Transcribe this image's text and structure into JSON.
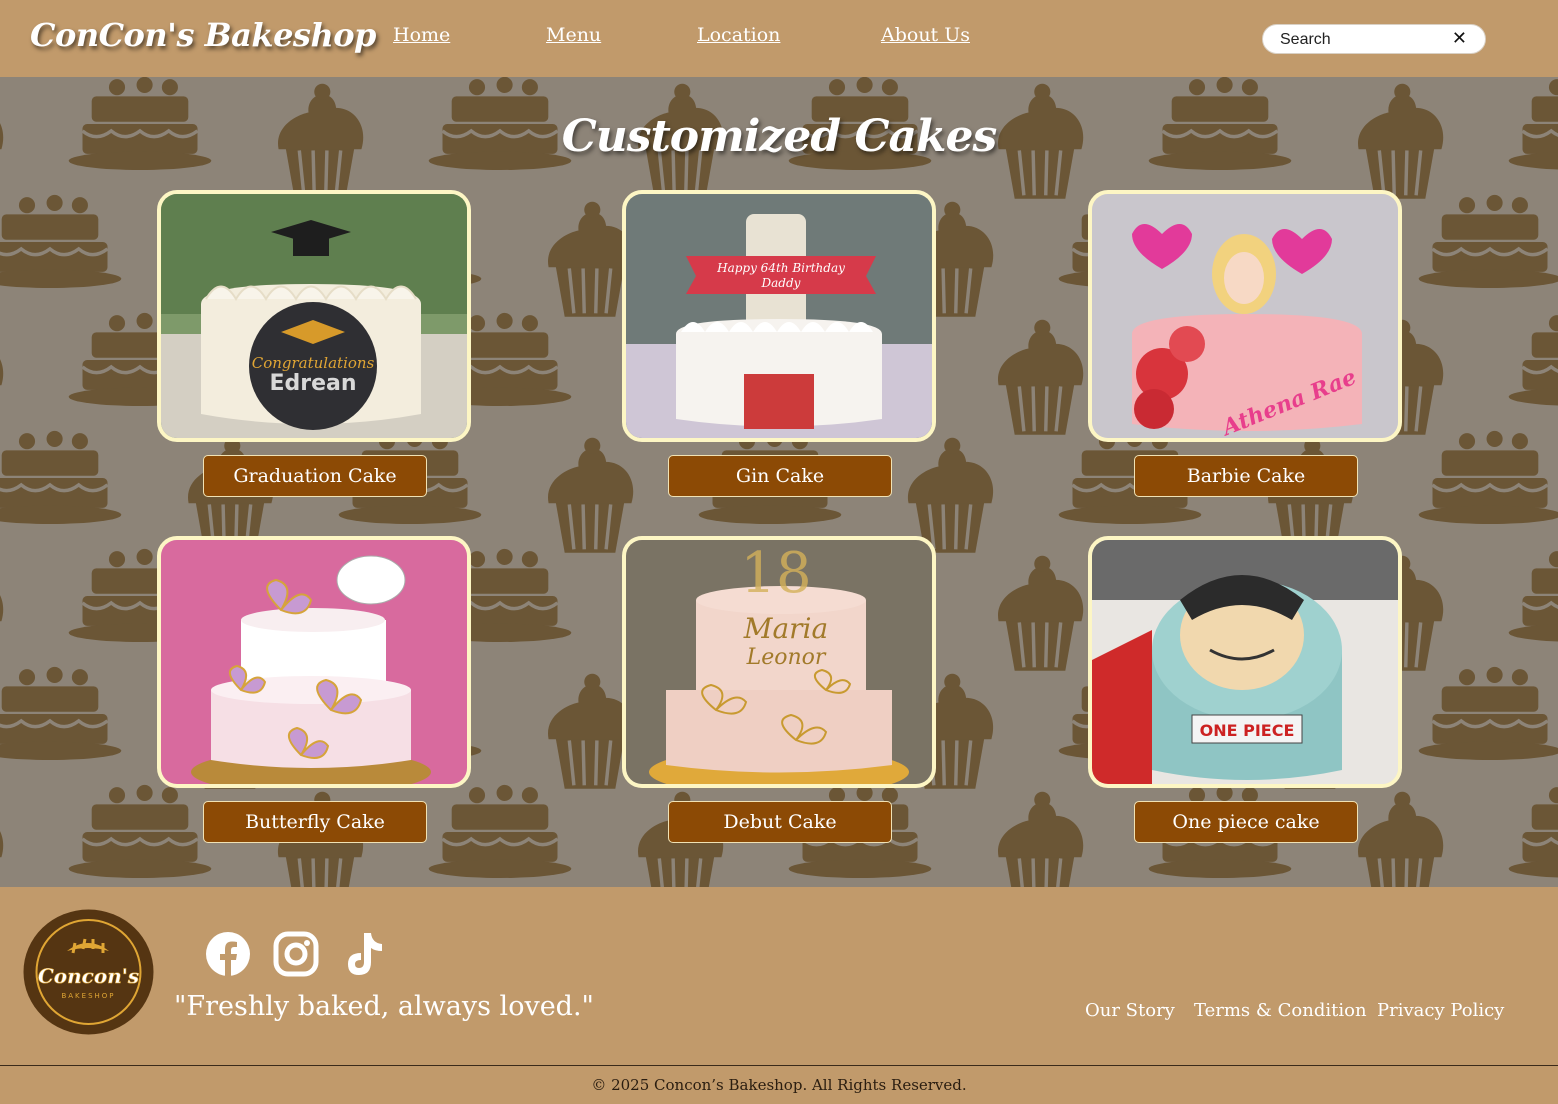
{
  "header": {
    "logo": "ConCon's Bakeshop",
    "nav": [
      "Home",
      "Menu",
      "Location",
      "About Us"
    ],
    "search": {
      "placeholder": "Search",
      "clear_icon": "close-icon"
    }
  },
  "main": {
    "title": "Customized Cakes",
    "cakes": [
      {
        "name": "Graduation Cake",
        "photo_text": "Congratulations Edrean"
      },
      {
        "name": "Gin Cake",
        "photo_text": "Happy 64th Birthday Daddy"
      },
      {
        "name": "Barbie Cake",
        "photo_text": "Athena Rae"
      },
      {
        "name": "Butterfly Cake",
        "photo_text": ""
      },
      {
        "name": "Debut Cake",
        "photo_text": "18 Maria Leonor"
      },
      {
        "name": "One piece cake",
        "photo_text": "ONE PIECE"
      }
    ]
  },
  "footer": {
    "logo": {
      "name": "Concon's",
      "sub": "BAKESHOP"
    },
    "social_icons": [
      "facebook-icon",
      "instagram-icon",
      "tiktok-icon"
    ],
    "tagline": "\"Freshly baked, always loved.\"",
    "links": [
      "Our Story",
      "Terms & Condition",
      "Privacy Policy"
    ],
    "copyright": "© 2025 Concon’s Bakeshop. All Rights Reserved."
  },
  "colors": {
    "header_bg": "#c19a6b",
    "button_bg": "#8c4a05",
    "photo_border": "#fdf6c4",
    "pattern": "#6b5636"
  }
}
